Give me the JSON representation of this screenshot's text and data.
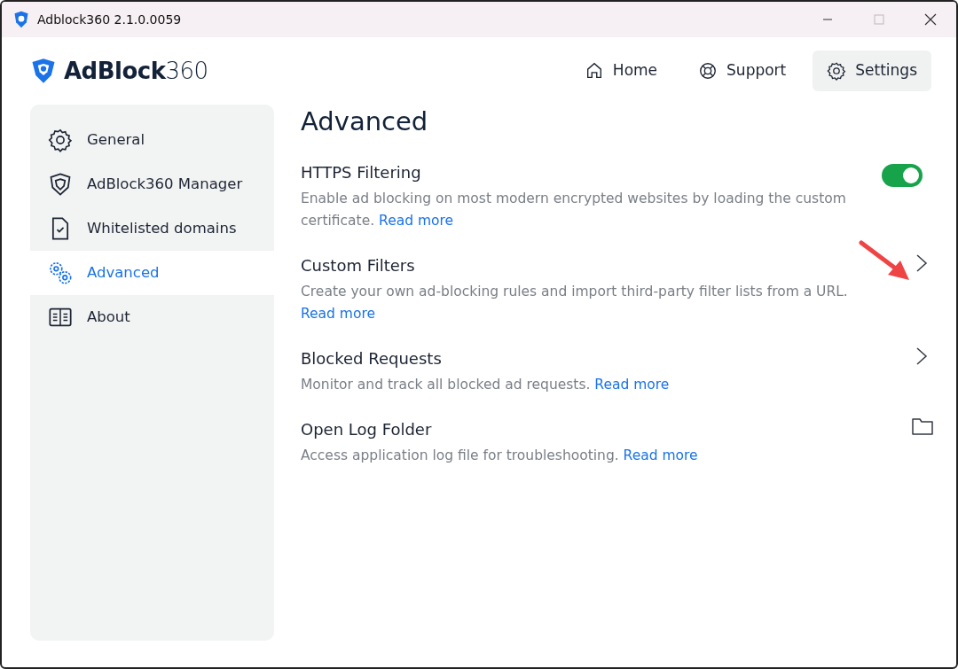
{
  "window": {
    "title": "Adblock360 2.1.0.0059"
  },
  "brand": {
    "bold": "AdBlock",
    "light": "360"
  },
  "nav": [
    {
      "label": "Home",
      "selected": false
    },
    {
      "label": "Support",
      "selected": false
    },
    {
      "label": "Settings",
      "selected": true
    }
  ],
  "sidebar": {
    "items": [
      {
        "label": "General",
        "selected": false
      },
      {
        "label": "AdBlock360 Manager",
        "selected": false
      },
      {
        "label": "Whitelisted domains",
        "selected": false
      },
      {
        "label": "Advanced",
        "selected": true
      },
      {
        "label": "About",
        "selected": false
      }
    ]
  },
  "page_title": "Advanced",
  "settings": [
    {
      "kind": "toggle",
      "title": "HTTPS Filtering",
      "description": "Enable ad blocking on most modern encrypted websites by loading the custom certificate.",
      "link": "Read more",
      "on": true
    },
    {
      "kind": "chevron",
      "title": "Custom Filters",
      "description": "Create your own ad-blocking rules and import third-party filter lists from a URL.",
      "link": "Read more"
    },
    {
      "kind": "chevron",
      "title": "Blocked Requests",
      "description": "Monitor and track all blocked ad requests.",
      "link": "Read more"
    },
    {
      "kind": "folder",
      "title": "Open Log Folder",
      "description": "Access application log file for troubleshooting.",
      "link": "Read more"
    }
  ]
}
